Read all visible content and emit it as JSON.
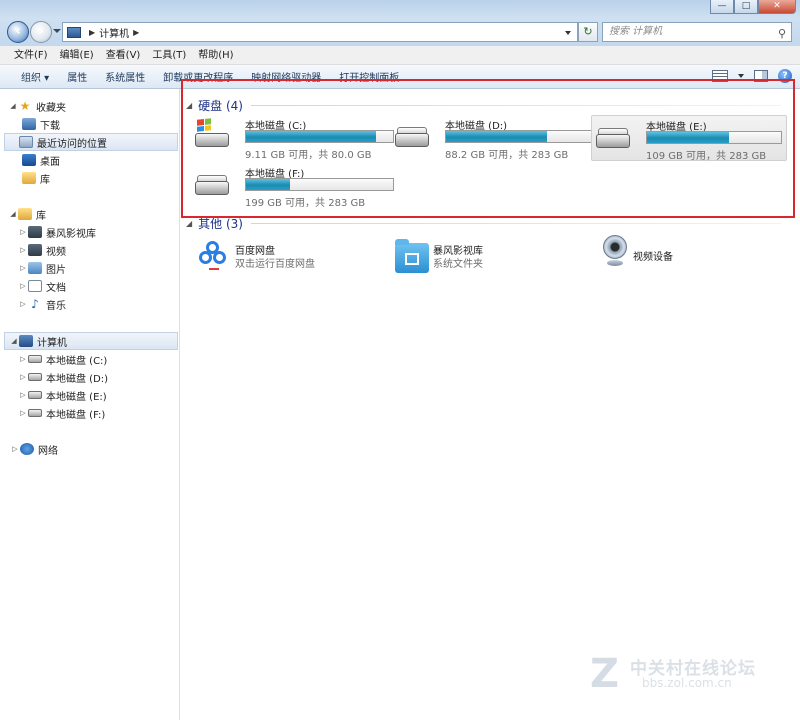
{
  "window": {
    "buttons": [
      "—",
      "□",
      "✕"
    ]
  },
  "address": {
    "path": "计算机",
    "search_placeholder": "搜索 计算机"
  },
  "menu": [
    "文件(F)",
    "编辑(E)",
    "查看(V)",
    "工具(T)",
    "帮助(H)"
  ],
  "commands": [
    "组织 ▾",
    "属性",
    "系统属性",
    "卸载或更改程序",
    "映射网络驱动器",
    "打开控制面板"
  ],
  "sidebar": {
    "favorites": {
      "label": "收藏夹",
      "items": [
        "下载",
        "最近访问的位置",
        "桌面",
        "库"
      ]
    },
    "libraries": {
      "label": "库",
      "items": [
        "暴风影视库",
        "视频",
        "图片",
        "文档",
        "音乐"
      ]
    },
    "computer": {
      "label": "计算机",
      "items": [
        "本地磁盘 (C:)",
        "本地磁盘 (D:)",
        "本地磁盘 (E:)",
        "本地磁盘 (F:)"
      ]
    },
    "network": {
      "label": "网络"
    }
  },
  "main": {
    "drives_header": "硬盘 (4)",
    "drives": [
      {
        "name": "本地磁盘 (C:)",
        "info": "9.11 GB 可用，共 80.0 GB",
        "used_fraction": 0.886
      },
      {
        "name": "本地磁盘 (D:)",
        "info": "88.2 GB 可用，共 283 GB",
        "used_fraction": 0.688
      },
      {
        "name": "本地磁盘 (E:)",
        "info": "109 GB 可用，共 283 GB",
        "used_fraction": 0.615
      },
      {
        "name": "本地磁盘 (F:)",
        "info": "199 GB 可用，共 283 GB",
        "used_fraction": 0.297
      }
    ],
    "other_header": "其他 (3)",
    "other": [
      {
        "name": "百度网盘",
        "desc": "双击运行百度网盘"
      },
      {
        "name": "暴风影视库",
        "desc": "系统文件夹"
      },
      {
        "name": "视频设备",
        "desc": ""
      }
    ]
  },
  "watermark": {
    "line1": "中关村在线论坛",
    "line2": "bbs.zol.com.cn"
  },
  "colors": {
    "highlight_border": "#d9282d",
    "bar_fill": "#1c8ab3",
    "group_header": "#1e3287"
  }
}
